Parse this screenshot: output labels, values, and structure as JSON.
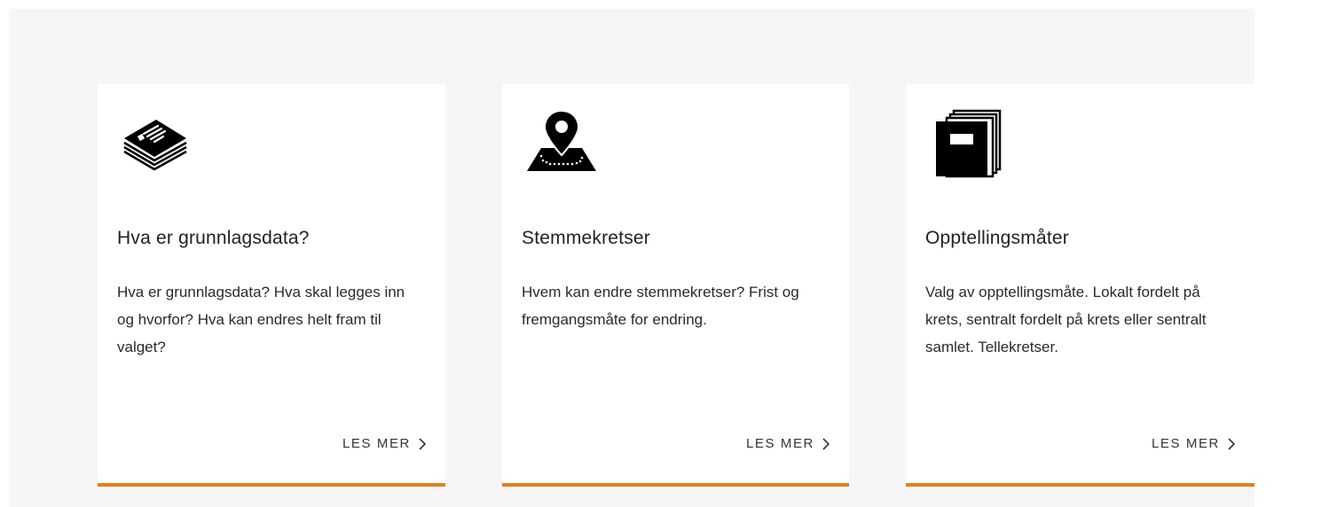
{
  "colors": {
    "section_background": "#f6f6f6",
    "card_background": "#ffffff",
    "accent": "#e67e22",
    "text": "#222222"
  },
  "cards": [
    {
      "icon": "newspaper-stack-icon",
      "title": "Hva er grunnlagsdata?",
      "text": "Hva er grunnlagsdata? Hva skal legges inn og hvorfor? Hva kan endres helt fram til valget?",
      "link_label": "LES MER",
      "link_icon": "chevron-right-icon"
    },
    {
      "icon": "map-pin-icon",
      "title": "Stemmekretser",
      "text": "Hvem kan endre stemmekretser? Frist og fremgangsmåte for endring.",
      "link_label": "LES MER",
      "link_icon": "chevron-right-icon"
    },
    {
      "icon": "binders-icon",
      "title": "Opptellingsmåter",
      "text": "Valg av opptellingsmåte. Lokalt fordelt på krets, sentralt fordelt på krets eller sentralt samlet. Tellekretser.",
      "link_label": "LES MER",
      "link_icon": "chevron-right-icon"
    }
  ]
}
